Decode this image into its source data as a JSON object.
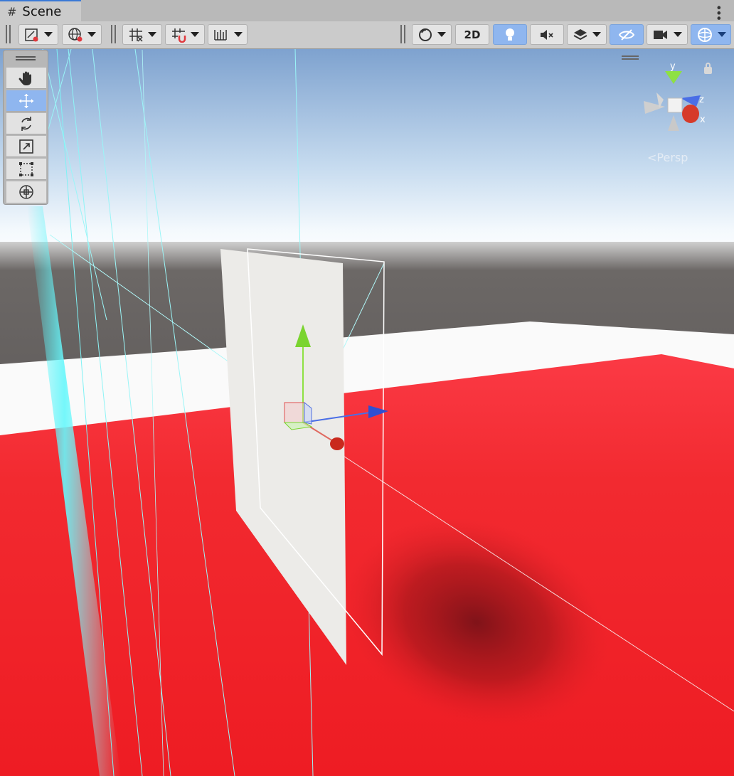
{
  "window": {
    "tab_title": "Scene",
    "menu_icon": "kebab-menu-icon"
  },
  "toolbar": {
    "left_buttons": [
      {
        "name": "draw-mode-button",
        "icon": "draw-mode-icon"
      },
      {
        "name": "global-toggle-button",
        "icon": "globe-icon"
      },
      {
        "name": "grid-snap-button",
        "icon": "grid-icon"
      },
      {
        "name": "snap-button",
        "icon": "magnet-grid-icon"
      },
      {
        "name": "increment-snap-button",
        "icon": "ruler-icon"
      }
    ],
    "right_buttons": [
      {
        "name": "shading-mode-button",
        "icon": "sphere-icon"
      },
      {
        "name": "2d-button",
        "label": "2D"
      },
      {
        "name": "lighting-button",
        "icon": "lightbulb-icon",
        "active": true
      },
      {
        "name": "audio-button",
        "icon": "mute-icon"
      },
      {
        "name": "effects-button",
        "icon": "layers-icon"
      },
      {
        "name": "hidden-toggle-button",
        "icon": "eye-crossed-icon",
        "active": true
      },
      {
        "name": "camera-button",
        "icon": "camera-icon"
      },
      {
        "name": "gizmos-button",
        "icon": "gizmo-icon",
        "active": true
      }
    ]
  },
  "tools": [
    {
      "name": "hand-tool",
      "icon": "hand-icon",
      "active": false
    },
    {
      "name": "move-tool",
      "icon": "move-icon",
      "active": true
    },
    {
      "name": "rotate-tool",
      "icon": "rotate-icon",
      "active": false
    },
    {
      "name": "scale-tool",
      "icon": "scale-icon",
      "active": false
    },
    {
      "name": "rect-tool",
      "icon": "rect-icon",
      "active": false
    },
    {
      "name": "transform-tool",
      "icon": "transform-icon",
      "active": false
    }
  ],
  "scene_gizmo": {
    "axis_y": "y",
    "axis_z": "z",
    "axis_x": "x",
    "projection": "Persp",
    "colors": {
      "x": "#d63a2a",
      "y": "#8ee043",
      "z": "#3a62e0"
    }
  },
  "scene": {
    "floor_color": "#f0262b",
    "sky_top": "#7fa2cf",
    "horizon": "#ffffff",
    "ground_far": "#6a6664"
  }
}
